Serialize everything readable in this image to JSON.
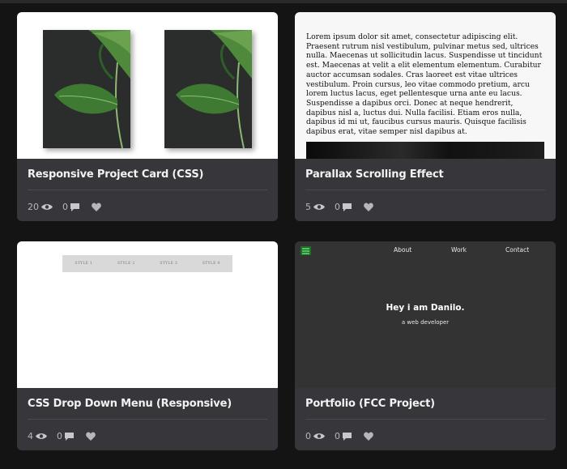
{
  "cards": [
    {
      "title": "Responsive Project Card (CSS)",
      "views": "20",
      "comments": "0",
      "preview": "two-monstera-leaf-photos"
    },
    {
      "title": "Parallax Scrolling Effect",
      "views": "5",
      "comments": "0",
      "preview": "lorem-text",
      "lorem": "Lorem ipsum dolor sit amet, consectetur adipiscing elit. Praesent rutrum nisl vestibulum, pulvinar metus sed, ultrices nulla. Maecenas ut sollicitudin lacus. Suspendisse ut tincidunt est. Maecenas at velit a elit elementum elementum. Curabitur auctor accumsan sodales. Cras laoreet est vitae ultrices vestibulum. Proin cursus, leo vitae commodo pretium, arcu lorem luctus lacus, eget pellentesque urna ante eu lacus. Suspendisse a dapibus orci. Donec at neque hendrerit, dapibus nisl a, luctus dui. Nulla facilisi. Etiam eros nulla, dapibus id mi ut, faucibus cursus mauris. Quisque facilisis dapibus erat, vitae semper nisl dapibus at."
    },
    {
      "title": "CSS Drop Down Menu (Responsive)",
      "views": "4",
      "comments": "0",
      "preview": "menu-bar",
      "menu": [
        "STYLE 1",
        "STYLE 2",
        "STYLE 3",
        "STYLE 4"
      ]
    },
    {
      "title": "Portfolio (FCC Project)",
      "views": "0",
      "comments": "0",
      "preview": "portfolio-site",
      "nav": [
        "About",
        "Work",
        "Contact"
      ],
      "heading": "Hey i am Danilo.",
      "subheading": "a web developer"
    }
  ],
  "colors": {
    "page_bg": "#141414",
    "card_footer": "#36363b",
    "title_text": "#f2f2f2",
    "meta_text": "#b7b7bb"
  },
  "icons": [
    "eye-icon",
    "comment-icon",
    "heart-icon",
    "menu-icon"
  ]
}
